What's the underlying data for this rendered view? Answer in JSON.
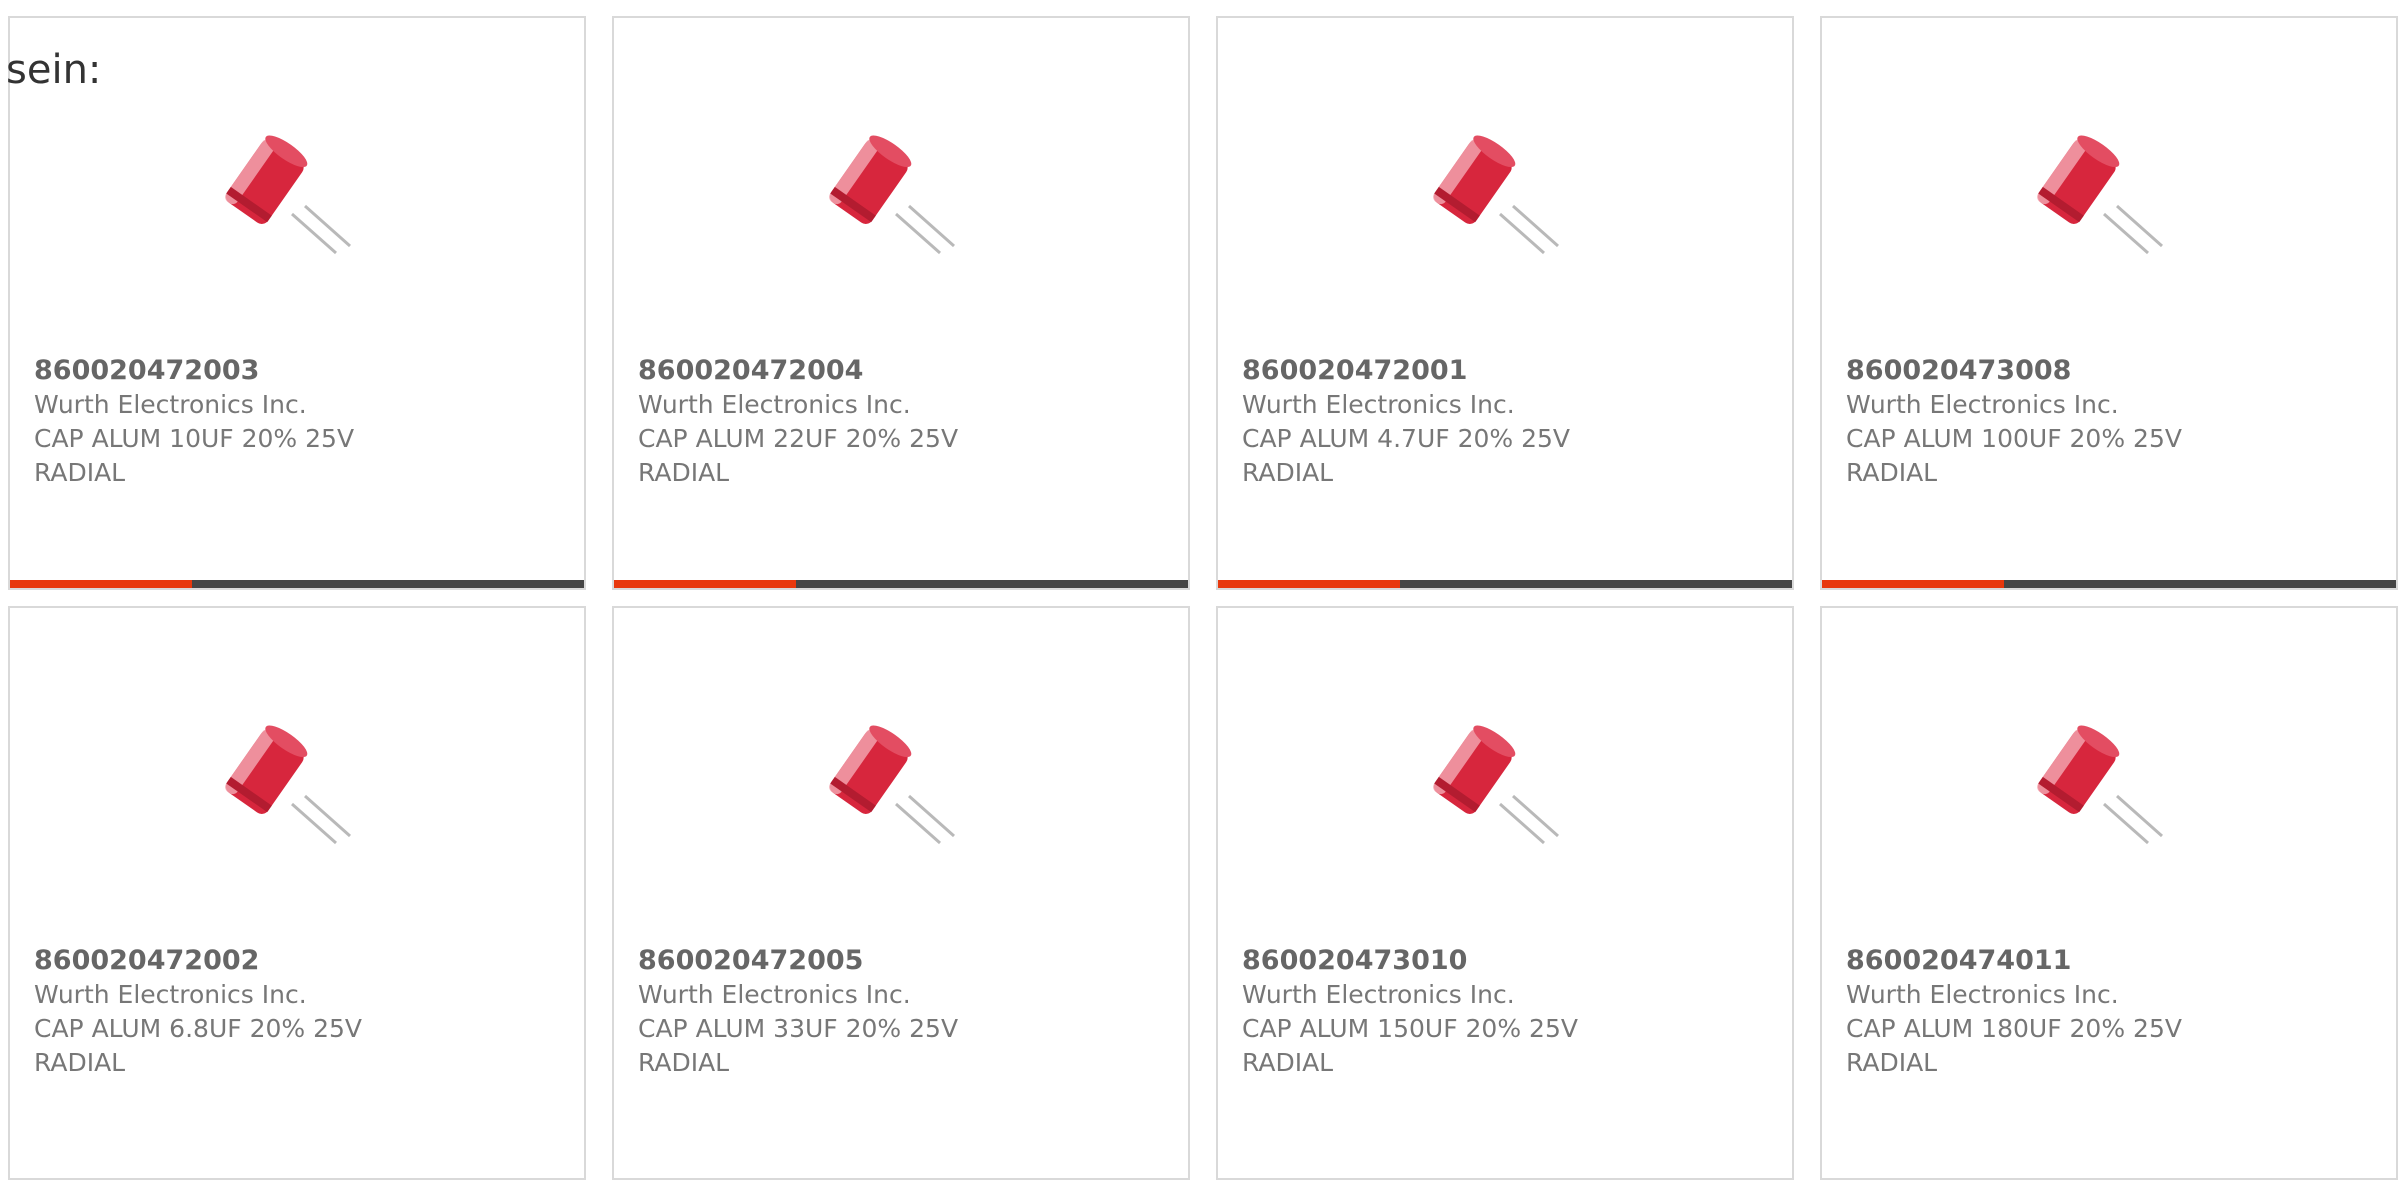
{
  "intro_text": "sein:",
  "icon": "capacitor-product-image",
  "colors": {
    "accent": "#e8380d",
    "bar_dark": "#454545",
    "card_border": "#d9d9d9",
    "text_gray": "#777777"
  },
  "products": [
    {
      "part_number": "860020472003",
      "manufacturer": "Wurth Electronics Inc.",
      "description": "CAP ALUM 10UF 20% 25V",
      "package": "RADIAL"
    },
    {
      "part_number": "860020472004",
      "manufacturer": "Wurth Electronics Inc.",
      "description": "CAP ALUM 22UF 20% 25V",
      "package": "RADIAL"
    },
    {
      "part_number": "860020472001",
      "manufacturer": "Wurth Electronics Inc.",
      "description": "CAP ALUM 4.7UF 20% 25V",
      "package": "RADIAL"
    },
    {
      "part_number": "860020473008",
      "manufacturer": "Wurth Electronics Inc.",
      "description": "CAP ALUM 100UF 20% 25V",
      "package": "RADIAL"
    },
    {
      "part_number": "860020472002",
      "manufacturer": "Wurth Electronics Inc.",
      "description": "CAP ALUM 6.8UF 20% 25V",
      "package": "RADIAL"
    },
    {
      "part_number": "860020472005",
      "manufacturer": "Wurth Electronics Inc.",
      "description": "CAP ALUM 33UF 20% 25V",
      "package": "RADIAL"
    },
    {
      "part_number": "860020473010",
      "manufacturer": "Wurth Electronics Inc.",
      "description": "CAP ALUM 150UF 20% 25V",
      "package": "RADIAL"
    },
    {
      "part_number": "860020474011",
      "manufacturer": "Wurth Electronics Inc.",
      "description": "CAP ALUM 180UF 20% 25V",
      "package": "RADIAL"
    }
  ]
}
